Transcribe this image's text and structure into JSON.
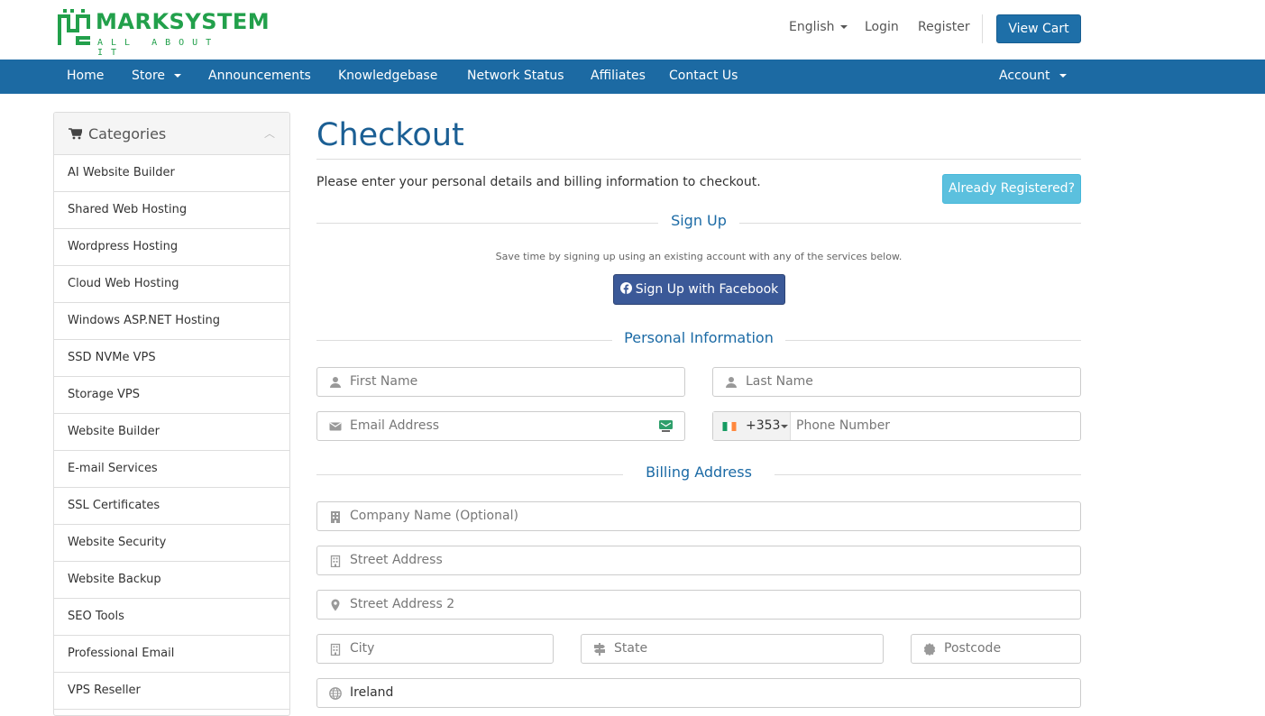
{
  "brand": {
    "name": "MARKSYSTEM",
    "tagline": "ALL ABOUT IT",
    "color": "#22a04b"
  },
  "topbar": {
    "language": "English",
    "login": "Login",
    "register": "Register",
    "view_cart": "View Cart"
  },
  "nav": {
    "items": [
      "Home",
      "Store",
      "Announcements",
      "Knowledgebase",
      "Network Status",
      "Affiliates",
      "Contact Us"
    ],
    "account": "Account",
    "background": "#1c6aa3"
  },
  "sidebar": {
    "title": "Categories",
    "items": [
      "AI Website Builder",
      "Shared Web Hosting",
      "Wordpress Hosting",
      "Cloud Web Hosting",
      "Windows ASP.NET Hosting",
      "SSD NVMe VPS",
      "Storage VPS",
      "Website Builder",
      "E-mail Services",
      "SSL Certificates",
      "Website Security",
      "Website Backup",
      "SEO Tools",
      "Professional Email",
      "VPS Reseller"
    ]
  },
  "checkout": {
    "title": "Checkout",
    "intro": "Please enter your personal details and billing information to checkout.",
    "already_registered": "Already Registered?",
    "signup": {
      "heading": "Sign Up",
      "note": "Save time by signing up using an existing account with any of the services below.",
      "facebook": "Sign Up with Facebook"
    },
    "personal": {
      "heading": "Personal Information",
      "first_name": "First Name",
      "last_name": "Last Name",
      "email": "Email Address",
      "phone_code": "+353",
      "phone": "Phone Number"
    },
    "billing": {
      "heading": "Billing Address",
      "company": "Company Name (Optional)",
      "street1": "Street Address",
      "street2": "Street Address 2",
      "city": "City",
      "state": "State",
      "postcode": "Postcode",
      "country": "Ireland"
    }
  }
}
